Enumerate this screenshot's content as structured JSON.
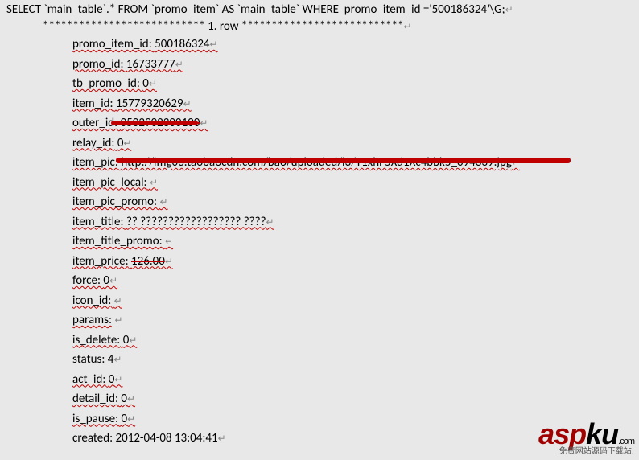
{
  "sql_query": "SELECT `main_table`.* FROM `promo_item` AS `main_table` WHERE  promo_item_id ='500186324'\\G;",
  "row_marker": "*************************** 1. row ***************************",
  "fields": {
    "promo_item_id": {
      "label": "promo_item_id:",
      "value": "500186324"
    },
    "promo_id": {
      "label": "promo_id:",
      "value": "16733777"
    },
    "tb_promo_id": {
      "label": "tb_promo_id:",
      "value": "0"
    },
    "item_id": {
      "label": "item_id:",
      "value": "15779320629"
    },
    "outer_id": {
      "label": "outer_id:",
      "value": "0502902300100"
    },
    "relay_id": {
      "label": "relay_id:",
      "value": "0"
    },
    "item_pic": {
      "label": "item_pic:",
      "value": "http://img03.taobaocdn.com/bao/uploaded/i3/T1xhF5Xd1Xc4bbk5_094339.jpg"
    },
    "item_pic_local": {
      "label": "item_pic_local:",
      "value": ""
    },
    "item_pic_promo": {
      "label": "item_pic_promo:",
      "value": ""
    },
    "item_title": {
      "label": "item_title:",
      "value": "?? ?????????????????? ????"
    },
    "item_title_promo": {
      "label": "item_title_promo:",
      "value": ""
    },
    "item_price": {
      "label": "item_price:",
      "value": "126.00"
    },
    "force": {
      "label": "force:",
      "value": "0"
    },
    "icon_id": {
      "label": "icon_id:",
      "value": ""
    },
    "params": {
      "label": "params:",
      "value": ""
    },
    "is_delete": {
      "label": "is_delete:",
      "value": "0"
    },
    "status": {
      "label": "status:",
      "value": "4"
    },
    "act_id": {
      "label": "act_id:",
      "value": "0"
    },
    "detail_id": {
      "label": "detail_id:",
      "value": "0"
    },
    "is_pause": {
      "label": "is_pause:",
      "value": "0"
    },
    "created": {
      "label": "created:",
      "value": "2012-04-08 13:04:41"
    }
  },
  "watermark": {
    "logo_text": "aspku",
    "domain": ".com",
    "tagline": "免费网站源码下载站!"
  }
}
